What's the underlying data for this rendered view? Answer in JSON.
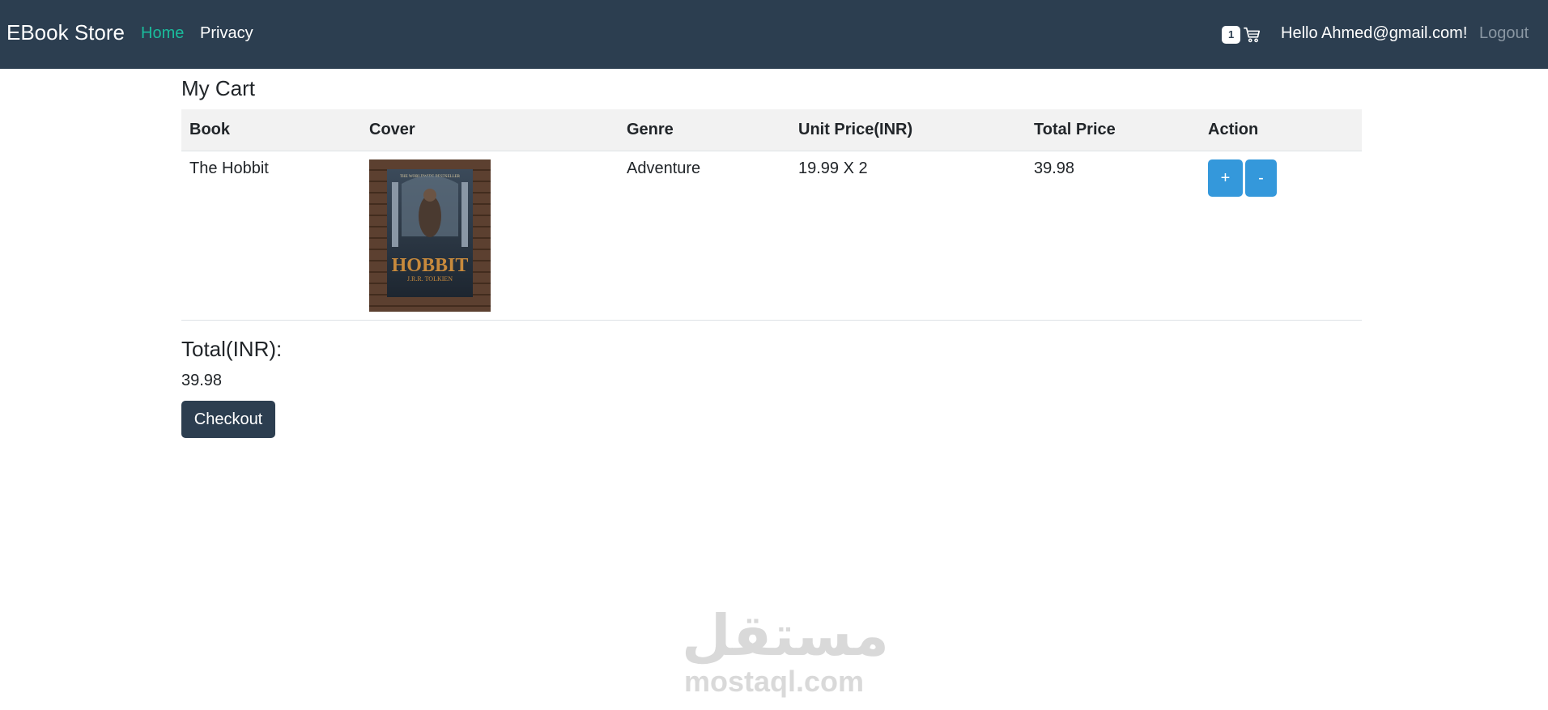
{
  "navbar": {
    "brand": "EBook Store",
    "links": [
      {
        "label": "Home",
        "active": true
      },
      {
        "label": "Privacy",
        "active": false
      }
    ],
    "cart_count": "1",
    "cart_icon": "shopping-cart-icon",
    "greeting": "Hello Ahmed@gmail.com!",
    "logout_label": "Logout"
  },
  "cart": {
    "title": "My Cart",
    "columns": [
      "Book",
      "Cover",
      "Genre",
      "Unit Price(INR)",
      "Total Price",
      "Action"
    ],
    "rows": [
      {
        "book": "The Hobbit",
        "cover": {
          "top_text": "THE WORLDWIDE BESTSELLER",
          "title": "HOBBIT",
          "author": "J.R.R. TOLKIEN"
        },
        "genre": "Adventure",
        "unit_price": "19.99 X 2",
        "total_price": "39.98",
        "plus_label": "+",
        "minus_label": "-"
      }
    ]
  },
  "summary": {
    "total_label": "Total(INR):",
    "total_value": "39.98",
    "checkout_label": "Checkout"
  },
  "watermark": {
    "arabic": "مستقل",
    "latin": "mostaql.com"
  },
  "colors": {
    "navbar_bg": "#2c3e50",
    "active_link": "#1abc9c",
    "action_button": "#3498db",
    "checkout_button": "#2c3e50"
  }
}
